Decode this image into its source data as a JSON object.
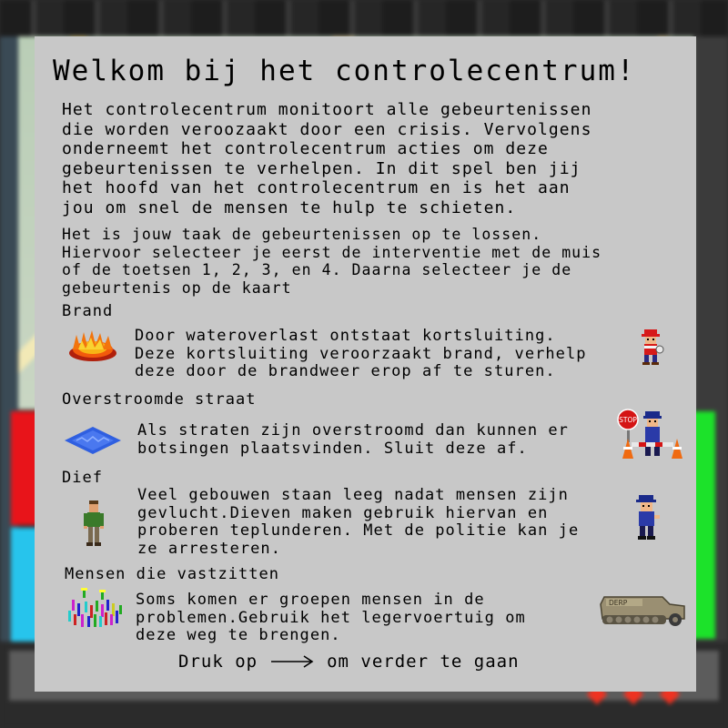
{
  "dialog": {
    "title": "Welkom bij het controlecentrum!",
    "intro": "Het controlecentrum monitoort alle gebeurtenissen\ndie worden veroozaakt door een crisis. Vervolgens\nonderneemt het controlecentrum acties om deze\ngebeurtenissen te verhelpen. In dit spel ben jij\nhet hoofd van het controlecentrum en is het aan\njou om snel de mensen te hulp te schieten.",
    "instructions": "Het is jouw taak de gebeurtenissen op te lossen.\nHiervoor selecteer je eerst de interventie met de muis\nof de toetsen 1, 2, 3,  en 4. Daarna selecteer je de\ngebeurtenis op de kaart",
    "events": [
      {
        "heading": "Brand",
        "text": "Door wateroverlast ontstaat kortsluiting.\nDeze kortsluiting veroorzaakt brand, verhelp\ndeze door de brandweer erop af te sturen.",
        "event_icon": "fire-icon",
        "responder_icon": "firefighter-icon"
      },
      {
        "heading": "Overstroomde straat",
        "text": "Als straten zijn overstroomd dan kunnen er\nbotsingen plaatsvinden. Sluit deze af.",
        "event_icon": "flooded-tile-icon",
        "responder_icon": "traffic-officer-icon",
        "sign_text": "STOP"
      },
      {
        "heading": "Dief",
        "text": "Veel gebouwen staan leeg nadat mensen zijn\ngevlucht.Dieven maken gebruik hiervan en\nproberen teplunderen. Met de politie kan je\nze arresteren.",
        "event_icon": "thief-icon",
        "responder_icon": "police-officer-icon"
      },
      {
        "heading": "Mensen die vastzitten",
        "text": "Soms komen er groepen mensen in de\nproblemen.Gebruik het legervoertuig om\ndeze weg te brengen.",
        "event_icon": "crowd-icon",
        "responder_icon": "army-vehicle-icon",
        "vehicle_text": "DERP"
      }
    ],
    "footer": {
      "before": "Druk op",
      "arrow_icon": "arrow-right-icon",
      "after": "om verder te gaan"
    }
  },
  "colors": {
    "dialog_bg": "#c8c8c8",
    "panel_red": "#e8141a",
    "panel_cyan": "#27c4ec",
    "panel_green": "#1ce22a"
  }
}
